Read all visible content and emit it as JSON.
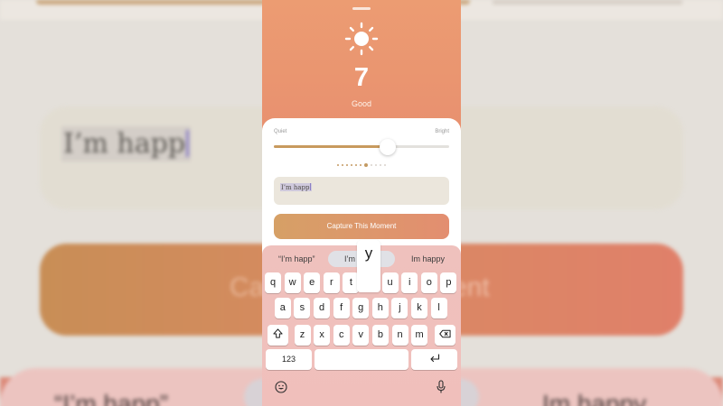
{
  "background": {
    "field_text": "I’m happ",
    "button_text_left": "Ca",
    "button_text_right": "ent",
    "suggestion_left": "“I’m happ”",
    "suggestion_right": "Im happy"
  },
  "header": {
    "score": "7",
    "label": "Good",
    "icon": "sun-icon"
  },
  "slider": {
    "left_label": "Quiet",
    "right_label": "Bright",
    "value": 0.65
  },
  "pager": {
    "total": 11,
    "current": 7
  },
  "entry": {
    "text": "I’m happ"
  },
  "capture_button": {
    "label": "Capture This Moment"
  },
  "keyboard": {
    "suggestions": [
      "“I’m happ”",
      "I’m",
      "Im happy"
    ],
    "popup_key": "y",
    "row1": [
      "q",
      "w",
      "e",
      "r",
      "t",
      "y",
      "u",
      "i",
      "o",
      "p"
    ],
    "row2": [
      "a",
      "s",
      "d",
      "f",
      "g",
      "h",
      "j",
      "k",
      "l"
    ],
    "row3": [
      "z",
      "x",
      "c",
      "v",
      "b",
      "n",
      "m"
    ],
    "numbers_label": "123",
    "shift_icon": "shift-icon",
    "delete_icon": "delete-icon",
    "return_icon": "return-icon",
    "emoji_icon": "emoji-icon",
    "mic_icon": "mic-icon"
  },
  "colors": {
    "accent_gold": "#c89a5e",
    "header_coral": "#e8906f",
    "keyboard_pink": "#efc1bd"
  }
}
